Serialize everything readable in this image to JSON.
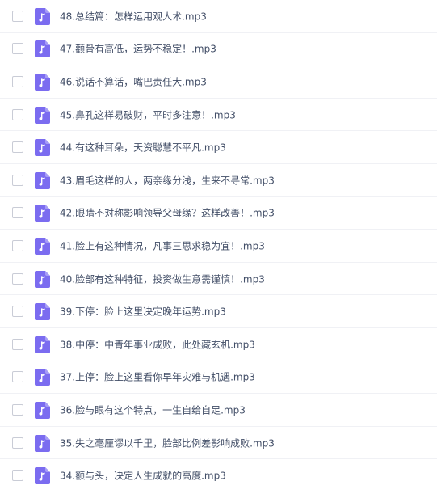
{
  "files": [
    {
      "name": "48.总结篇：怎样运用观人术.mp3",
      "icon": "audio-file-icon"
    },
    {
      "name": "47.颧骨有高低，运势不稳定！.mp3",
      "icon": "audio-file-icon"
    },
    {
      "name": "46.说话不算话，嘴巴责任大.mp3",
      "icon": "audio-file-icon"
    },
    {
      "name": "45.鼻孔这样易破财，平时多注意！.mp3",
      "icon": "audio-file-icon"
    },
    {
      "name": "44.有这种耳朵，天资聪慧不平凡.mp3",
      "icon": "audio-file-icon"
    },
    {
      "name": "43.眉毛这样的人，两亲缘分浅，生来不寻常.mp3",
      "icon": "audio-file-icon"
    },
    {
      "name": "42.眼睛不对称影响领导父母缘？这样改善！.mp3",
      "icon": "audio-file-icon"
    },
    {
      "name": "41.脸上有这种情况，凡事三思求稳为宜！.mp3",
      "icon": "audio-file-icon"
    },
    {
      "name": "40.脸部有这种特征，投资做生意需谨慎！.mp3",
      "icon": "audio-file-icon"
    },
    {
      "name": "39.下停：脸上这里决定晚年运势.mp3",
      "icon": "audio-file-icon"
    },
    {
      "name": "38.中停：中青年事业成败，此处藏玄机.mp3",
      "icon": "audio-file-icon"
    },
    {
      "name": "37.上停：脸上这里看你早年灾难与机遇.mp3",
      "icon": "audio-file-icon"
    },
    {
      "name": "36.脸与眼有这个特点，一生自给自足.mp3",
      "icon": "audio-file-icon"
    },
    {
      "name": "35.失之毫厘谬以千里，脸部比例差影响成败.mp3",
      "icon": "audio-file-icon"
    },
    {
      "name": "34.额与头，决定人生成就的高度.mp3",
      "icon": "audio-file-icon"
    }
  ],
  "colors": {
    "icon_bg": "#7b6cf0",
    "text": "#424e67",
    "divider": "#f0f1f5",
    "checkbox_border": "#c9ccd6"
  }
}
